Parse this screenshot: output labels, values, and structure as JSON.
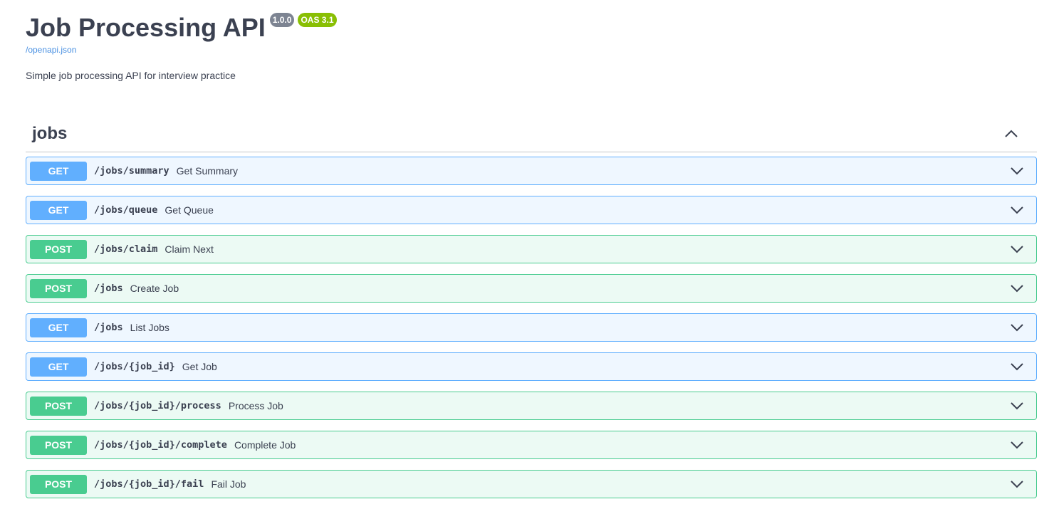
{
  "info": {
    "title": "Job Processing API",
    "version": "1.0.0",
    "oas": "OAS 3.1",
    "spec_link": "/openapi.json",
    "description": "Simple job processing API for interview practice"
  },
  "tag": {
    "name": "jobs",
    "toggle_icon": "chevron-up-icon"
  },
  "colors": {
    "get": "#61affe",
    "post": "#49cc90",
    "version_badge": "#7d8492",
    "oas_badge": "#89bf04",
    "link": "#4990e2",
    "text": "#3b4151"
  },
  "operations": [
    {
      "method": "GET",
      "path": "/jobs/summary",
      "summary": "Get Summary"
    },
    {
      "method": "GET",
      "path": "/jobs/queue",
      "summary": "Get Queue"
    },
    {
      "method": "POST",
      "path": "/jobs/claim",
      "summary": "Claim Next"
    },
    {
      "method": "POST",
      "path": "/jobs",
      "summary": "Create Job"
    },
    {
      "method": "GET",
      "path": "/jobs",
      "summary": "List Jobs"
    },
    {
      "method": "GET",
      "path": "/jobs/{job_id}",
      "summary": "Get Job"
    },
    {
      "method": "POST",
      "path": "/jobs/{job_id}/process",
      "summary": "Process Job"
    },
    {
      "method": "POST",
      "path": "/jobs/{job_id}/complete",
      "summary": "Complete Job"
    },
    {
      "method": "POST",
      "path": "/jobs/{job_id}/fail",
      "summary": "Fail Job"
    }
  ]
}
